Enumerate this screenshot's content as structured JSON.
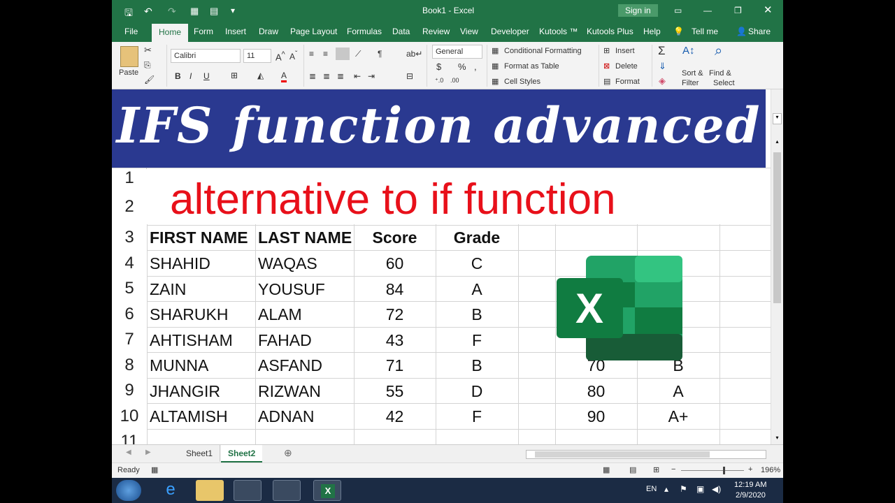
{
  "window": {
    "title": "Book1  -  Excel",
    "sign_in": "Sign in"
  },
  "menu_tabs": [
    "File",
    "Home",
    "Form",
    "Insert",
    "Draw",
    "Page Layout",
    "Formulas",
    "Data",
    "Review",
    "View",
    "Developer",
    "Kutools ™",
    "Kutools Plus",
    "Help",
    "Tell me",
    "Share"
  ],
  "ribbon": {
    "paste": "Paste",
    "font_name": "Calibri",
    "font_size": "11",
    "bold": "B",
    "italic": "I",
    "underline": "U",
    "number_format": "General",
    "currency": "$",
    "percent": "%",
    "conditional_formatting": "Conditional Formatting",
    "format_as_table": "Format as Table",
    "cell_styles": "Cell Styles",
    "insert": "Insert",
    "delete": "Delete",
    "format": "Format",
    "sort_filter_1": "Sort &",
    "sort_filter_2": "Filter",
    "find_select_1": "Find &",
    "find_select_2": "Select",
    "autosum": "Σ"
  },
  "banner": {
    "title": "IFS function advanced"
  },
  "subtitle": "alternative to if function",
  "row_numbers": [
    "1",
    "2",
    "3",
    "4",
    "5",
    "6",
    "7",
    "8",
    "9",
    "10",
    "11"
  ],
  "table": {
    "headers": [
      "FIRST NAME",
      "LAST NAME",
      "Score",
      "Grade"
    ],
    "rows": [
      [
        "SHAHID",
        "WAQAS",
        "60",
        "C"
      ],
      [
        "ZAIN",
        "YOUSUF",
        "84",
        "A"
      ],
      [
        "SHARUKH",
        "ALAM",
        "72",
        "B"
      ],
      [
        "AHTISHAM",
        "FAHAD",
        "43",
        "F"
      ],
      [
        "MUNNA",
        "ASFAND",
        "71",
        "B"
      ],
      [
        "JHANGIR",
        "RIZWAN",
        "55",
        "D"
      ],
      [
        "ALTAMISH",
        "ADNAN",
        "42",
        "F"
      ]
    ]
  },
  "lookup": [
    [
      "70",
      "B"
    ],
    [
      "80",
      "A"
    ],
    [
      "90",
      "A+"
    ]
  ],
  "sheet_tabs": [
    "Sheet1",
    "Sheet2"
  ],
  "status": {
    "ready": "Ready",
    "zoom": "196%"
  },
  "taskbar": {
    "lang": "EN",
    "time": "12:19 AM",
    "date": "2/9/2020"
  },
  "colors": {
    "excel_green": "#217346",
    "banner_blue": "#2a3990",
    "subtitle_red": "#e8101a"
  }
}
